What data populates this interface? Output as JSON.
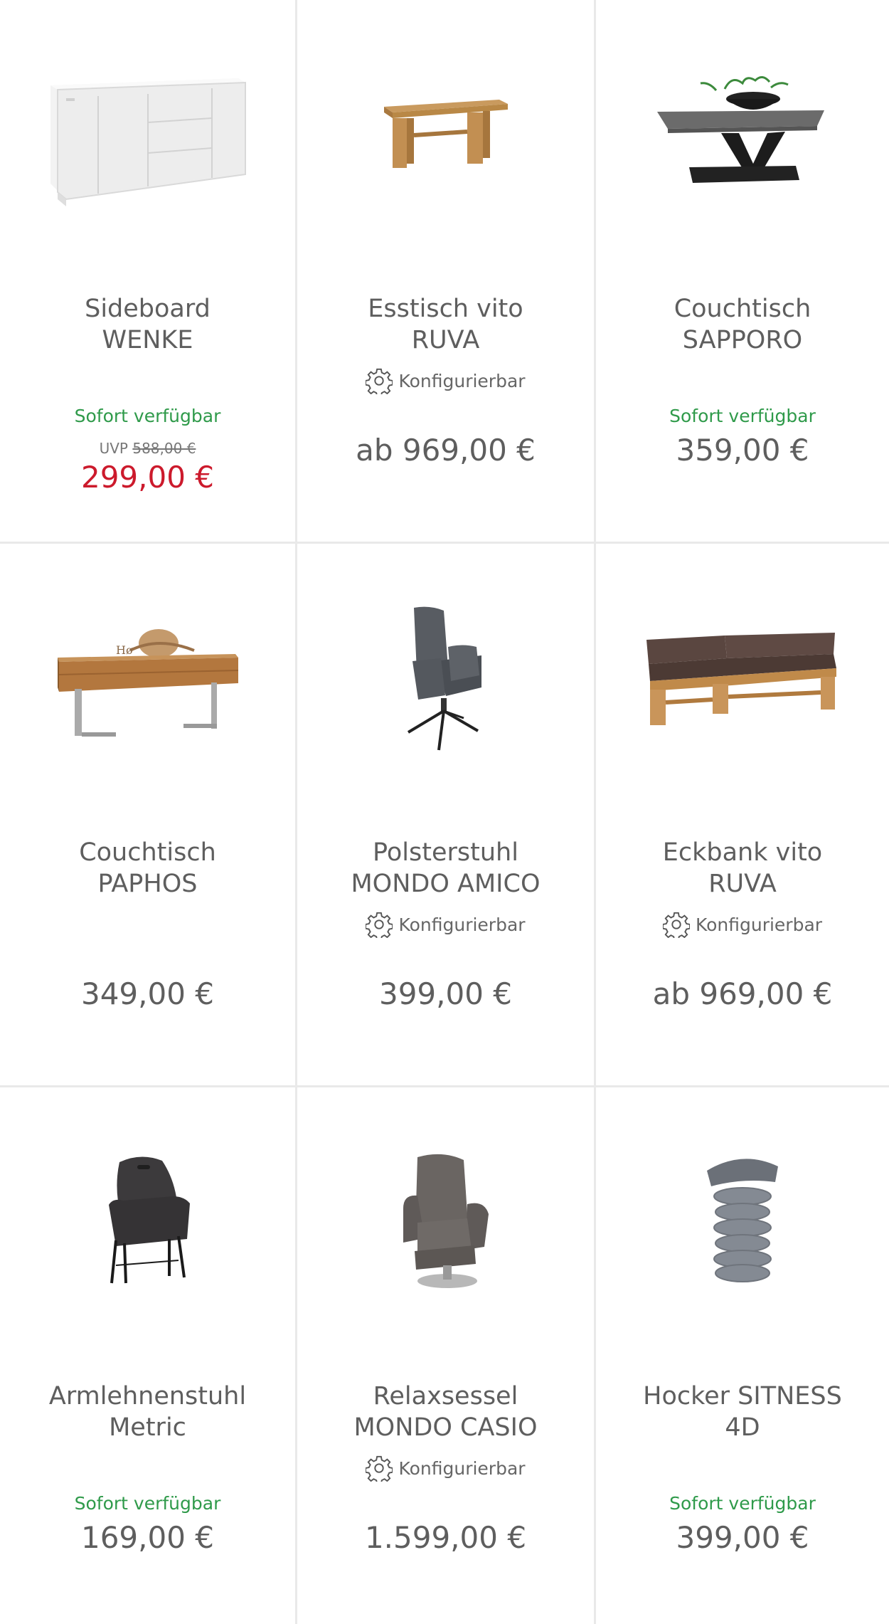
{
  "colors": {
    "available": "#2f9a4a",
    "sale": "#cc1a2c",
    "text": "#5e5e5e",
    "divider": "#e9e9e9"
  },
  "products": [
    {
      "name_line1": "Sideboard",
      "name_line2": "WENKE",
      "configurable": "",
      "availability": "Sofort verfügbar",
      "uvp_label": "UVP",
      "uvp_old": "588,00 €",
      "price": "299,00 €",
      "image_icon": "sideboard-icon"
    },
    {
      "name_line1": "Esstisch vito",
      "name_line2": "RUVA",
      "configurable": "Konfigurierbar",
      "availability": "",
      "uvp_label": "",
      "uvp_old": "",
      "price": "ab 969,00 €",
      "image_icon": "dining-table-icon"
    },
    {
      "name_line1": "Couchtisch",
      "name_line2": "SAPPORO",
      "configurable": "",
      "availability": "Sofort verfügbar",
      "uvp_label": "",
      "uvp_old": "",
      "price": "359,00 €",
      "image_icon": "coffee-table-icon"
    },
    {
      "name_line1": "Couchtisch",
      "name_line2": "PAPHOS",
      "configurable": "",
      "availability": "",
      "uvp_label": "",
      "uvp_old": "",
      "price": "349,00 €",
      "image_icon": "wood-coffee-table-icon"
    },
    {
      "name_line1": "Polsterstuhl",
      "name_line2": "MONDO AMICO",
      "configurable": "Konfigurierbar",
      "availability": "",
      "uvp_label": "",
      "uvp_old": "",
      "price": "399,00 €",
      "image_icon": "upholstered-chair-icon"
    },
    {
      "name_line1": "Eckbank vito",
      "name_line2": "RUVA",
      "configurable": "Konfigurierbar",
      "availability": "",
      "uvp_label": "",
      "uvp_old": "",
      "price": "ab 969,00 €",
      "image_icon": "corner-bench-icon"
    },
    {
      "name_line1": "Armlehnenstuhl",
      "name_line2": "Metric",
      "configurable": "",
      "availability": "Sofort verfügbar",
      "uvp_label": "",
      "uvp_old": "",
      "price": "169,00 €",
      "image_icon": "armchair-icon"
    },
    {
      "name_line1": "Relaxsessel",
      "name_line2": "MONDO CASIO",
      "configurable": "Konfigurierbar",
      "availability": "",
      "uvp_label": "",
      "uvp_old": "",
      "price": "1.599,00 €",
      "image_icon": "recliner-icon"
    },
    {
      "name_line1": "Hocker SITNESS",
      "name_line2": "4D",
      "configurable": "",
      "availability": "Sofort verfügbar",
      "uvp_label": "",
      "uvp_old": "",
      "price": "399,00 €",
      "image_icon": "stool-icon"
    }
  ]
}
